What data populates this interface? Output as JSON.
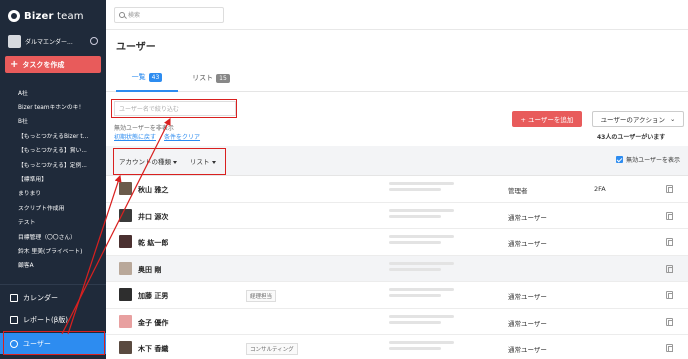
{
  "brand": {
    "name_bold": "Bizer",
    "name_light": " team"
  },
  "sidebar": {
    "profile_name": "ダルマエンダー...",
    "task_button": "タスクを作成",
    "projects": [
      "A社",
      "Bizer teamキホンのキ！",
      "B社",
      "【もっとつかえるBizer t...",
      "【もっとつかえる】賞い...",
      "【もっとつかえる】定例...",
      "【標準用】",
      "まりまり",
      "スクリプト作成用",
      "テスト",
      "目標管理（〇〇さん）",
      "鈴木 里美(プライベート)",
      "顧客A"
    ],
    "nav": {
      "calendar": "カレンダー",
      "report": "レポート(β版)",
      "users": "ユーザー"
    }
  },
  "topbar": {
    "search_placeholder": "検索"
  },
  "page": {
    "title": "ユーザー",
    "tabs": [
      {
        "label": "一覧",
        "count": "43"
      },
      {
        "label": "リスト",
        "count": "15"
      }
    ],
    "filter_placeholder": "ユーザー名で絞り込む",
    "hide_inactive": "無効ユーザーを非表示",
    "reset_link": "初期状態に戻す",
    "clear_link": "条件をクリア",
    "add_user": "+ ユーザーを追加",
    "user_action": "ユーザーのアクション",
    "user_count": "43人のユーザーがいます",
    "account_type": "アカウントの種類",
    "list_filter": "リスト",
    "show_inactive": "無効ユーザーを表示"
  },
  "users": [
    {
      "name": "秋山 雅之",
      "tag": "",
      "role": "管理者",
      "twofa": "2FA",
      "avatar_color": "#6b5a4a",
      "highlight": false
    },
    {
      "name": "井口 源次",
      "tag": "",
      "role": "通常ユーザー",
      "twofa": "",
      "avatar_color": "#3a3a3a",
      "highlight": false
    },
    {
      "name": "乾 紘一郎",
      "tag": "",
      "role": "通常ユーザー",
      "twofa": "",
      "avatar_color": "#4a3030",
      "highlight": false
    },
    {
      "name": "奥田 剛",
      "tag": "",
      "role": "",
      "twofa": "",
      "avatar_color": "#b9a89a",
      "highlight": true
    },
    {
      "name": "加藤 正男",
      "tag": "経理担当",
      "role": "通常ユーザー",
      "twofa": "",
      "avatar_color": "#2e2e2e",
      "highlight": false
    },
    {
      "name": "金子 優作",
      "tag": "",
      "role": "通常ユーザー",
      "twofa": "",
      "avatar_color": "#e8a0a0",
      "highlight": false
    },
    {
      "name": "木下 香織",
      "tag": "コンサルティング",
      "role": "通常ユーザー",
      "twofa": "",
      "avatar_color": "#5a4a40",
      "highlight": false
    }
  ],
  "colors": {
    "accent": "#2d8cf0",
    "danger": "#e85b5b",
    "sidebar": "#1f2a3a",
    "annotation": "#d9201f"
  }
}
